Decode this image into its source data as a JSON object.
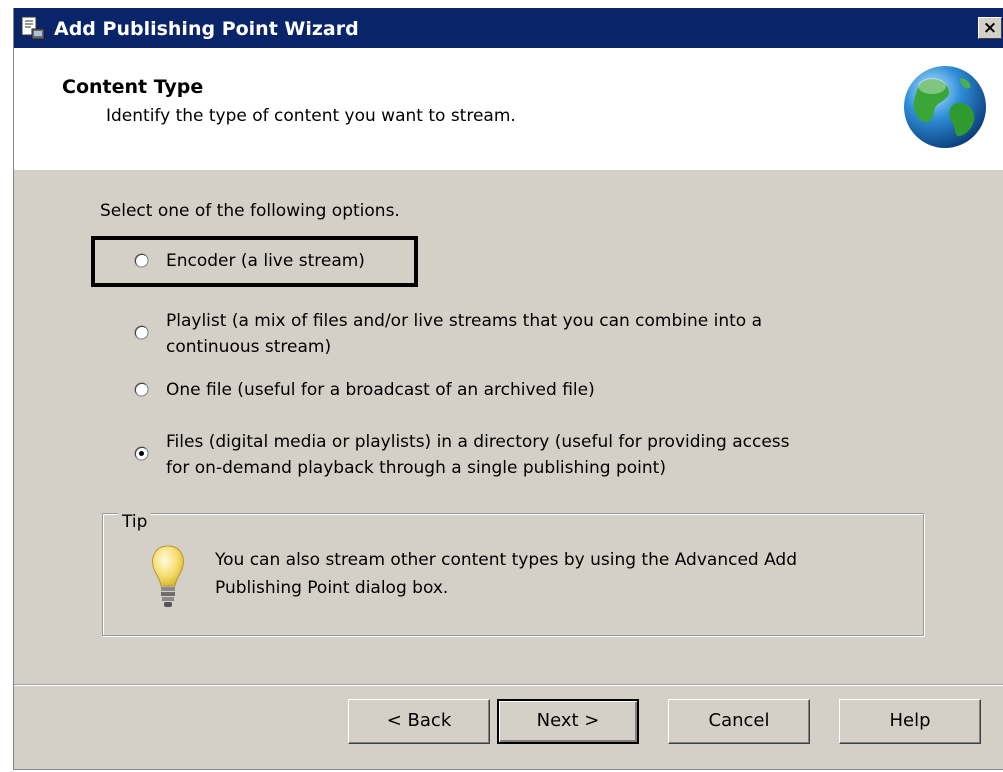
{
  "window": {
    "title": "Add Publishing Point Wizard",
    "close_glyph": "×"
  },
  "header": {
    "title": "Content Type",
    "subtitle": "Identify the type of content you want to stream."
  },
  "body": {
    "prompt": "Select one of the following options.",
    "options": [
      {
        "line1": "Encoder (a live stream)",
        "line2": "",
        "selected": false
      },
      {
        "line1": "Playlist (a mix of files and/or live streams that you can combine into a",
        "line2": "continuous stream)",
        "selected": false
      },
      {
        "line1": "One file (useful for a broadcast of an archived file)",
        "line2": "",
        "selected": false
      },
      {
        "line1": "Files (digital media or playlists) in a directory (useful for providing access",
        "line2": "for on-demand playback through a single publishing point)",
        "selected": true
      }
    ]
  },
  "tip": {
    "legend": "Tip",
    "line1": "You can also stream other content types by using the Advanced Add",
    "line2": "Publishing Point dialog box."
  },
  "buttons": {
    "back": "< Back",
    "next": "Next >",
    "cancel": "Cancel",
    "help": "Help"
  },
  "colors": {
    "titlebar": "#0a246a",
    "dialog_face": "#d4d0c8",
    "highlight_box": "#000000"
  },
  "icons": [
    "wizard-app-icon",
    "close-icon",
    "globe-icon",
    "lightbulb-icon",
    "radio-icon"
  ]
}
